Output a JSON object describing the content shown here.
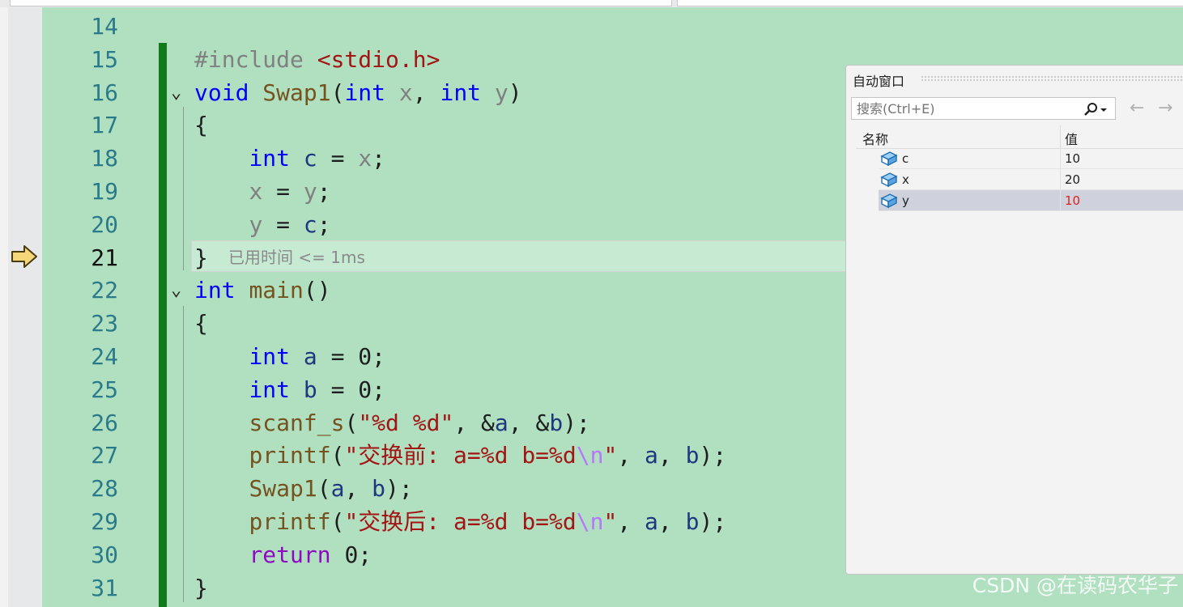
{
  "editor": {
    "lines": [
      {
        "num": "14",
        "tokens": []
      },
      {
        "num": "15",
        "tokens": [
          {
            "t": "#include ",
            "c": "pp"
          },
          {
            "t": "<stdio.h>",
            "c": "inc"
          }
        ]
      },
      {
        "num": "16",
        "fold": true,
        "tokens": [
          {
            "t": "void",
            "c": "kw"
          },
          {
            "t": " "
          },
          {
            "t": "Swap1",
            "c": "fn"
          },
          {
            "t": "("
          },
          {
            "t": "int",
            "c": "kw"
          },
          {
            "t": " "
          },
          {
            "t": "x",
            "c": "par"
          },
          {
            "t": ", "
          },
          {
            "t": "int",
            "c": "kw"
          },
          {
            "t": " "
          },
          {
            "t": "y",
            "c": "par"
          },
          {
            "t": ")"
          }
        ]
      },
      {
        "num": "17",
        "tokens": [
          {
            "t": "{"
          }
        ]
      },
      {
        "num": "18",
        "tokens": [
          {
            "t": "    "
          },
          {
            "t": "int",
            "c": "kw"
          },
          {
            "t": " "
          },
          {
            "t": "c",
            "c": "var"
          },
          {
            "t": " = "
          },
          {
            "t": "x",
            "c": "par"
          },
          {
            "t": ";"
          }
        ]
      },
      {
        "num": "19",
        "tokens": [
          {
            "t": "    "
          },
          {
            "t": "x",
            "c": "par"
          },
          {
            "t": " = "
          },
          {
            "t": "y",
            "c": "par"
          },
          {
            "t": ";"
          }
        ]
      },
      {
        "num": "20",
        "tokens": [
          {
            "t": "    "
          },
          {
            "t": "y",
            "c": "par"
          },
          {
            "t": " = "
          },
          {
            "t": "c",
            "c": "var"
          },
          {
            "t": ";"
          }
        ]
      },
      {
        "num": "21",
        "current": true,
        "tokens": [
          {
            "t": "}"
          }
        ]
      },
      {
        "num": "22",
        "fold": true,
        "tokens": [
          {
            "t": "int",
            "c": "kw"
          },
          {
            "t": " "
          },
          {
            "t": "main",
            "c": "fn"
          },
          {
            "t": "()"
          }
        ]
      },
      {
        "num": "23",
        "tokens": [
          {
            "t": "{"
          }
        ]
      },
      {
        "num": "24",
        "tokens": [
          {
            "t": "    "
          },
          {
            "t": "int",
            "c": "kw"
          },
          {
            "t": " "
          },
          {
            "t": "a",
            "c": "var"
          },
          {
            "t": " = 0;"
          }
        ]
      },
      {
        "num": "25",
        "tokens": [
          {
            "t": "    "
          },
          {
            "t": "int",
            "c": "kw"
          },
          {
            "t": " "
          },
          {
            "t": "b",
            "c": "var"
          },
          {
            "t": " = 0;"
          }
        ]
      },
      {
        "num": "26",
        "tokens": [
          {
            "t": "    "
          },
          {
            "t": "scanf_s",
            "c": "fn"
          },
          {
            "t": "("
          },
          {
            "t": "\"%d %d\"",
            "c": "str"
          },
          {
            "t": ", &"
          },
          {
            "t": "a",
            "c": "var"
          },
          {
            "t": ", &"
          },
          {
            "t": "b",
            "c": "var"
          },
          {
            "t": ");"
          }
        ]
      },
      {
        "num": "27",
        "tokens": [
          {
            "t": "    "
          },
          {
            "t": "printf",
            "c": "fn"
          },
          {
            "t": "("
          },
          {
            "t": "\"交换前: a=%d b=%d",
            "c": "str"
          },
          {
            "t": "\\n",
            "c": "esc"
          },
          {
            "t": "\"",
            "c": "str"
          },
          {
            "t": ", "
          },
          {
            "t": "a",
            "c": "var"
          },
          {
            "t": ", "
          },
          {
            "t": "b",
            "c": "var"
          },
          {
            "t": ");"
          }
        ]
      },
      {
        "num": "28",
        "tokens": [
          {
            "t": "    "
          },
          {
            "t": "Swap1",
            "c": "fn"
          },
          {
            "t": "("
          },
          {
            "t": "a",
            "c": "var"
          },
          {
            "t": ", "
          },
          {
            "t": "b",
            "c": "var"
          },
          {
            "t": ");"
          }
        ]
      },
      {
        "num": "29",
        "tokens": [
          {
            "t": "    "
          },
          {
            "t": "printf",
            "c": "fn"
          },
          {
            "t": "("
          },
          {
            "t": "\"交换后: a=%d b=%d",
            "c": "str"
          },
          {
            "t": "\\n",
            "c": "esc"
          },
          {
            "t": "\"",
            "c": "str"
          },
          {
            "t": ", "
          },
          {
            "t": "a",
            "c": "var"
          },
          {
            "t": ", "
          },
          {
            "t": "b",
            "c": "var"
          },
          {
            "t": ");"
          }
        ]
      },
      {
        "num": "30",
        "tokens": [
          {
            "t": "    "
          },
          {
            "t": "return",
            "c": "kw2"
          },
          {
            "t": " 0;"
          }
        ]
      },
      {
        "num": "31",
        "tokens": [
          {
            "t": "}"
          }
        ]
      }
    ],
    "elapsed_label": "已用时间",
    "elapsed_value": "<= 1ms"
  },
  "autos": {
    "title": "自动窗口",
    "search_placeholder": "搜索(Ctrl+E)",
    "col_name": "名称",
    "col_value": "值",
    "rows": [
      {
        "name": "c",
        "value": "10",
        "changed": false,
        "selected": false
      },
      {
        "name": "x",
        "value": "20",
        "changed": false,
        "selected": false
      },
      {
        "name": "y",
        "value": "10",
        "changed": true,
        "selected": true
      }
    ]
  },
  "watermark": "CSDN @在读码农华子",
  "colors": {
    "editor_bg": "#b0e0c0",
    "keyword": "#0000ff",
    "string": "#a31515",
    "changed_value": "#e02020"
  }
}
